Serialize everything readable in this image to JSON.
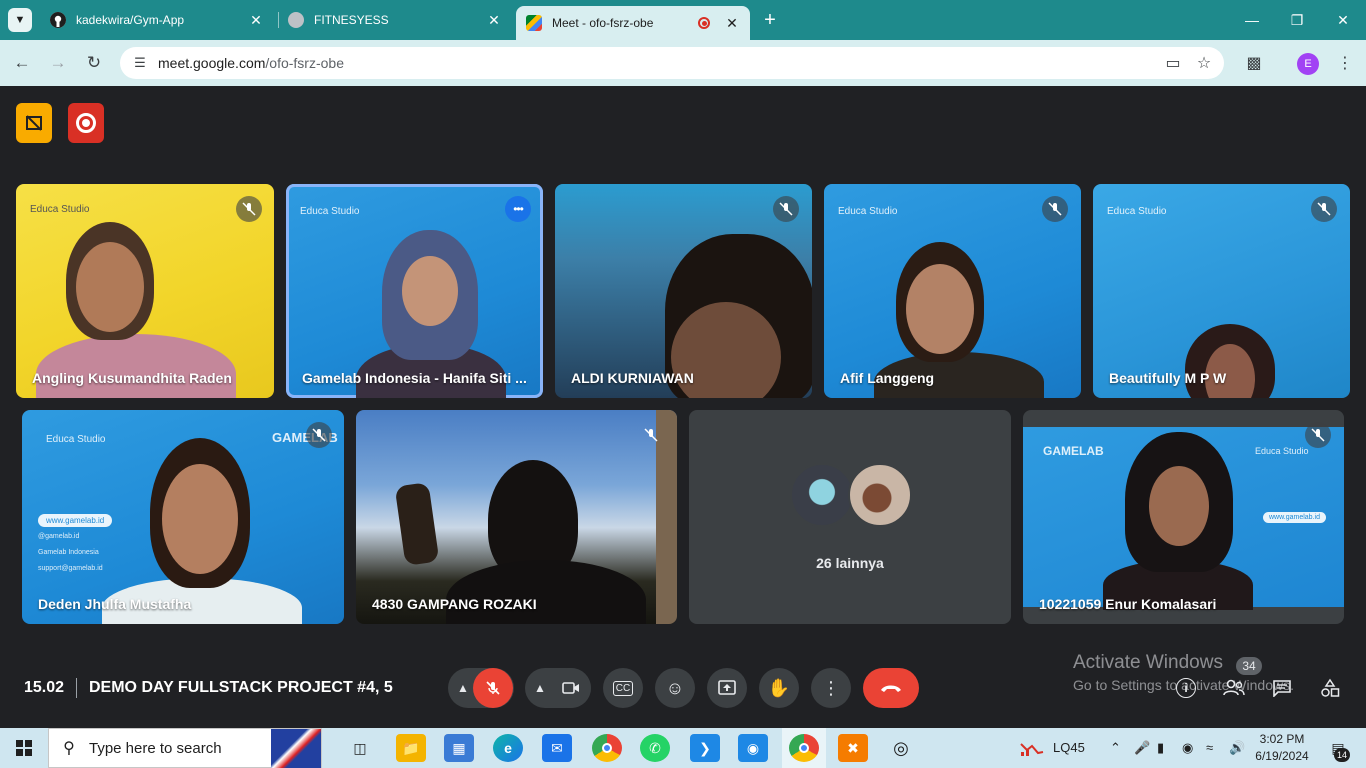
{
  "browser": {
    "tabs": [
      {
        "title": "kadekwira/Gym-App",
        "favicon": "github-icon"
      },
      {
        "title": "FITNESYESS",
        "favicon": "globe-icon"
      },
      {
        "title": "Meet - ofo-fsrz-obe",
        "favicon": "google-meet-icon",
        "recording": true
      }
    ],
    "url_host": "meet.google.com",
    "url_path": "/ofo-fsrz-obe",
    "profile_initial": "E",
    "tab_strip_color": "#1e8a8c",
    "toolbar_color": "#d8eef0"
  },
  "meet": {
    "participants_row1": [
      {
        "name": "Angling Kusumandhita Raden",
        "muted": true
      },
      {
        "name": "Gamelab Indonesia - Hanifa Siti ...",
        "speaking": true
      },
      {
        "name": "ALDI KURNIAWAN",
        "muted": true
      },
      {
        "name": "Afif Langgeng",
        "muted": true
      },
      {
        "name": "Beautifully M P W",
        "muted": true
      }
    ],
    "participants_row2": [
      {
        "name": "Deden Jhulfa Mustafha",
        "muted": true
      },
      {
        "name": "4830 GAMPANG ROZAKI",
        "muted": true
      },
      {
        "name": "26 lainnya"
      },
      {
        "name": "10221059 Enur Komalasari",
        "muted": true
      }
    ],
    "background_text": {
      "educa": "Educa Studio",
      "gamelab": "GAMELAB",
      "site": "www.gamelab.id",
      "handle": "@gamelab.id",
      "org": "Gamelab Indonesia",
      "email": "support@gamelab.id"
    },
    "time": "15.02",
    "meeting_title": "DEMO DAY FULLSTACK PROJECT #4, 5",
    "people_count": "34",
    "accent_red": "#ea4335",
    "accent_blue": "#1a73e8"
  },
  "watermark": {
    "line1": "Activate Windows",
    "line2": "Go to Settings to activate Windows."
  },
  "taskbar": {
    "search_placeholder": "Type here to search",
    "weather": "LQ45",
    "time": "3:02 PM",
    "date": "6/19/2024",
    "notifications": "14"
  }
}
